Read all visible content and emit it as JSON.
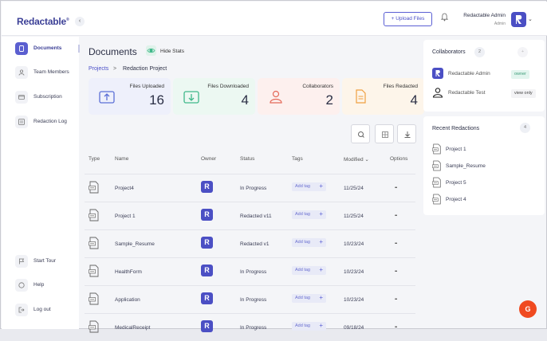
{
  "app": {
    "logo": "Redactable",
    "upload_label": "+ Upload Files",
    "user_name": "Redactable Admin",
    "user_role": "Admin",
    "collapse_glyph": "‹"
  },
  "sidebar": {
    "top_items": [
      {
        "label": "Documents",
        "icon": "document-icon",
        "active": true
      },
      {
        "label": "Team Members",
        "icon": "user-icon",
        "active": false
      },
      {
        "label": "Subscription",
        "icon": "card-icon",
        "active": false
      },
      {
        "label": "Redaction Log",
        "icon": "log-icon",
        "active": false
      }
    ],
    "bottom_items": [
      {
        "label": "Start Tour",
        "icon": "flag-icon"
      },
      {
        "label": "Help",
        "icon": "chat-icon"
      },
      {
        "label": "Log out",
        "icon": "logout-icon"
      }
    ]
  },
  "main": {
    "title": "Documents",
    "hide_stats_label": "Hide Stats",
    "breadcrumb": {
      "parent": "Projects",
      "separator": ">",
      "current": "Redaction Project"
    },
    "stats": [
      {
        "label": "Files Uploaded",
        "value": "16",
        "color": "#5b6fd6",
        "bg": "#eef0fb"
      },
      {
        "label": "Files Downloaded",
        "value": "4",
        "color": "#3fb88a",
        "bg": "#ecf8f2"
      },
      {
        "label": "Collaborators",
        "value": "2",
        "color": "#e46a5a",
        "bg": "#fdf0ee"
      },
      {
        "label": "Files Redacted",
        "value": "4",
        "color": "#f0a040",
        "bg": "#fdf5ea"
      }
    ],
    "table": {
      "headers": {
        "type": "Type",
        "name": "Name",
        "owner": "Owner",
        "status": "Status",
        "tags": "Tags",
        "modified": "Modified",
        "options": "Options"
      },
      "rows": [
        {
          "name": "Project4",
          "owner": "R",
          "status": "In Progress",
          "tag": "Add tag",
          "modified": "11/25/24"
        },
        {
          "name": "Project 1",
          "owner": "R",
          "status": "Redacted v11",
          "tag": "Add tag",
          "modified": "11/25/24"
        },
        {
          "name": "Sample_Resume",
          "owner": "R",
          "status": "Redacted v1",
          "tag": "Add tag",
          "modified": "10/23/24"
        },
        {
          "name": "HealthForm",
          "owner": "R",
          "status": "In Progress",
          "tag": "Add tag",
          "modified": "10/23/24"
        },
        {
          "name": "Application",
          "owner": "R",
          "status": "In Progress",
          "tag": "Add tag",
          "modified": "10/23/24"
        },
        {
          "name": "MedicalReceipt",
          "owner": "R",
          "status": "In Progress",
          "tag": "Add tag",
          "modified": "09/18/24"
        }
      ]
    }
  },
  "collaborators": {
    "title": "Collaborators",
    "count": "2",
    "items": [
      {
        "name": "Redactable Admin",
        "role": "owner"
      },
      {
        "name": "Redactable Test",
        "role": "view only"
      }
    ]
  },
  "recent": {
    "title": "Recent Redactions",
    "count": "4",
    "items": [
      "Project 1",
      "Sample_Resume",
      "Project 5",
      "Project 4"
    ]
  },
  "badge": {
    "text": "G"
  }
}
